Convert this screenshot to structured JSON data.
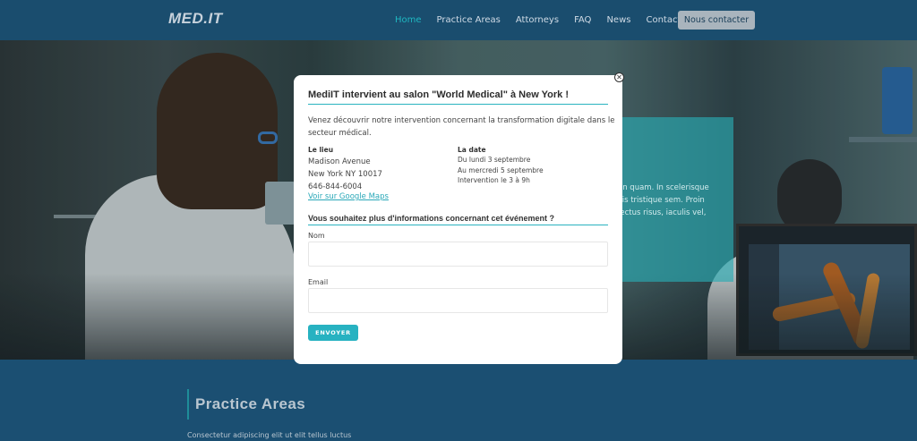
{
  "header": {
    "logo": "MED.IT",
    "nav": [
      {
        "label": "Home",
        "active": true
      },
      {
        "label": "Practice Areas",
        "active": false
      },
      {
        "label": "Attorneys",
        "active": false
      },
      {
        "label": "FAQ",
        "active": false
      },
      {
        "label": "News",
        "active": false
      },
      {
        "label": "Contact Us",
        "active": false
      }
    ],
    "cta_label": "Nous contacter"
  },
  "hero": {
    "card_lines": [
      "an quam. In scelerisque",
      "llis tristique sem. Proin",
      "lectus risus, iaculis vel,"
    ]
  },
  "section": {
    "title": "Practice Areas",
    "subtitle": "Consectetur adipiscing elit ut elit tellus luctus"
  },
  "modal": {
    "title": "MediIT intervient au salon \"World Medical\" à New York !",
    "intro_lines": [
      "Venez découvrir notre intervention concernant la transformation digitale dans le",
      "secteur médical."
    ],
    "lieu": {
      "heading": "Le lieu",
      "lines": [
        "Madison Avenue",
        "New York NY 10017",
        "646-844-6004"
      ],
      "map_link": "Voir sur Google Maps"
    },
    "date": {
      "heading": "La date",
      "lines": [
        "Du lundi 3 septembre",
        "Au mercredi 5 septembre",
        "Intervention le 3 à 9h"
      ]
    },
    "form": {
      "heading": "Vous souhaitez plus d'informations concernant cet événement ?",
      "name_label": "Nom",
      "name_value": "",
      "email_label": "Email",
      "email_value": "",
      "submit_label": "ENVOYER"
    },
    "close_icon": "close-icon"
  },
  "colors": {
    "header_bg": "#1a4d6e",
    "accent": "#27b2c1",
    "cta_bg": "#a9b4bd"
  }
}
